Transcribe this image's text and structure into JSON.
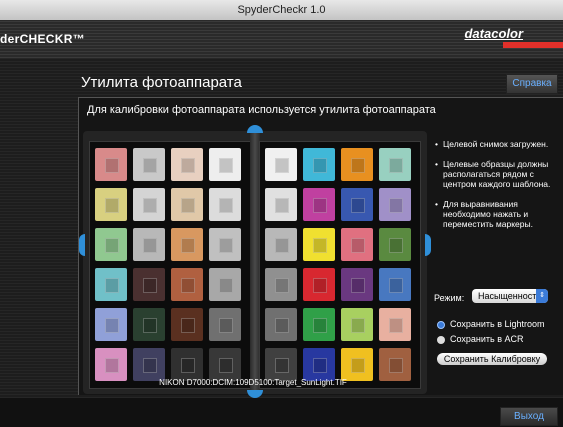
{
  "window": {
    "title": "SpyderCheckr 1.0"
  },
  "brand": {
    "left": "derCHECKR™",
    "right": "datacolor"
  },
  "page": {
    "title": "Утилита фотоаппарата",
    "help_button": "Справка",
    "panel_title": "Для калибровки фотоаппарата используется утилита фотоаппарата"
  },
  "notes": [
    "Целевой снимок загружен.",
    "Целевые образцы должны располагаться рядом с центром каждого шаблона.",
    "Для выравнивания необходимо нажать и переместить маркеры."
  ],
  "note_bullet": "•",
  "mode": {
    "label": "Режим:",
    "value": "Насыщенность"
  },
  "save_options": [
    {
      "label": "Сохранить в Lightroom",
      "selected": true
    },
    {
      "label": "Сохранить в ACR",
      "selected": false
    }
  ],
  "save_button": "Сохранить Калибровку",
  "filename": "NIKON D7000:DCIM:109D5100:Target_SunLight.TIF",
  "exit_button": "Выход",
  "colors": {
    "accent_blue": "#2f8fd8",
    "brand_red": "#e2302a",
    "left_card": [
      [
        "#d88a8a",
        "#c9c9c9",
        "#e8d0c0",
        "#eeeeee"
      ],
      [
        "#d8d080",
        "#d4d4d4",
        "#e0c8a8",
        "#dcdcdc"
      ],
      [
        "#90c890",
        "#b8b8b8",
        "#d89860",
        "#c0c0c0"
      ],
      [
        "#70c0c8",
        "#4a3030",
        "#b06040",
        "#a8a8a8"
      ],
      [
        "#90a0d8",
        "#2a4030",
        "#5a3020",
        "#707070"
      ],
      [
        "#d890c0",
        "#404060",
        "#303030",
        "#383838"
      ]
    ],
    "right_card": [
      [
        "#f0f0f0",
        "#40b8d8",
        "#e89020",
        "#98d0c0"
      ],
      [
        "#e0e0e0",
        "#c040a0",
        "#3858b0",
        "#a090c8"
      ],
      [
        "#b8b8b8",
        "#f0e030",
        "#e07080",
        "#5a8a40"
      ],
      [
        "#909090",
        "#d82830",
        "#6a3880",
        "#4878c0"
      ],
      [
        "#707070",
        "#30a048",
        "#a8d060",
        "#e8b0a0"
      ],
      [
        "#404040",
        "#2838a0",
        "#f0c020",
        "#a06040"
      ]
    ]
  }
}
